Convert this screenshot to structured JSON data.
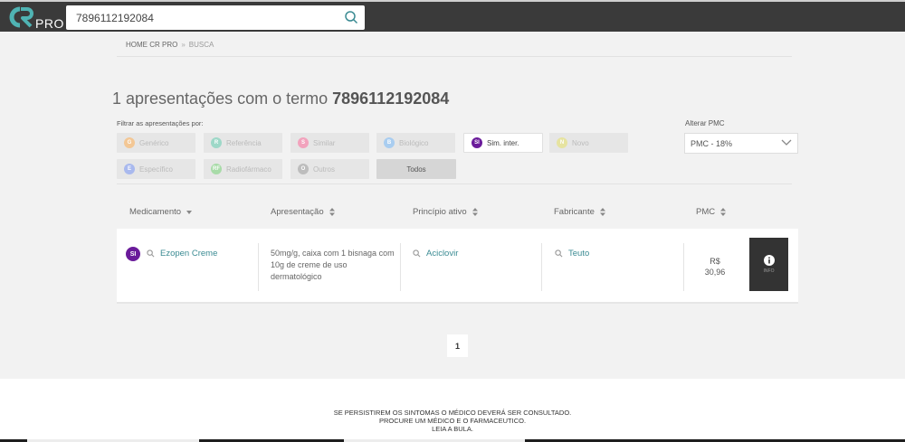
{
  "header": {
    "logo_text": "PRO",
    "search": {
      "value": "7896112192084",
      "placeholder": ""
    }
  },
  "breadcrumb": {
    "home": "HOME CR PRO",
    "separator": "»",
    "current": "BUSCA"
  },
  "results": {
    "title_prefix": "1 apresentações com o termo ",
    "term": "7896112192084"
  },
  "filters": {
    "label": "Filtrar as apresentações por:",
    "chips": [
      {
        "badge": "G",
        "label": "Genérico",
        "color": "#f3c795"
      },
      {
        "badge": "R",
        "label": "Referência",
        "color": "#9ed8c8"
      },
      {
        "badge": "S",
        "label": "Similar",
        "color": "#f2a3bd"
      },
      {
        "badge": "B",
        "label": "Biológico",
        "color": "#a9cdf0"
      },
      {
        "badge": "SI",
        "label": "Sim. inter.",
        "color": "#6a1b9a"
      },
      {
        "badge": "N",
        "label": "Novo",
        "color": "#e6e3a0"
      },
      {
        "badge": "E",
        "label": "Específico",
        "color": "#a9b9ee"
      },
      {
        "badge": "RF",
        "label": "Radiofármaco",
        "color": "#a8dba8"
      },
      {
        "badge": "O",
        "label": "Outros",
        "color": "#bdbdbd"
      }
    ],
    "todos_label": "Todos",
    "active_badge": "SI"
  },
  "pmc": {
    "label": "Alterar PMC",
    "selected": "PMC - 18%"
  },
  "table": {
    "headers": [
      "Medicamento",
      "Apresentação",
      "Princípio ativo",
      "Fabricante",
      "PMC"
    ],
    "rows": [
      {
        "badge": "SI",
        "medicamento": "Ezopen Creme",
        "apresentacao": "50mg/g, caixa com 1 bisnaga com 10g de creme de uso dermatológico",
        "principio_ativo": "Aciclovir",
        "fabricante": "Teuto",
        "pmc_currency": "R$",
        "pmc_value": "30,96",
        "info_label": "INFO"
      }
    ]
  },
  "pagination": {
    "current": "1"
  },
  "footer": {
    "lines": [
      "SE PERSISTIREM OS SINTOMAS O MÉDICO DEVERÁ SER CONSULTADO.",
      "PROCURE UM MÉDICO E O FARMACEUTICO.",
      "LEIA A BULA."
    ]
  },
  "colors": {
    "accent_teal": "#3b8b93",
    "header_bg": "#3a3a3a",
    "sim_inter": "#6a1b9a"
  }
}
